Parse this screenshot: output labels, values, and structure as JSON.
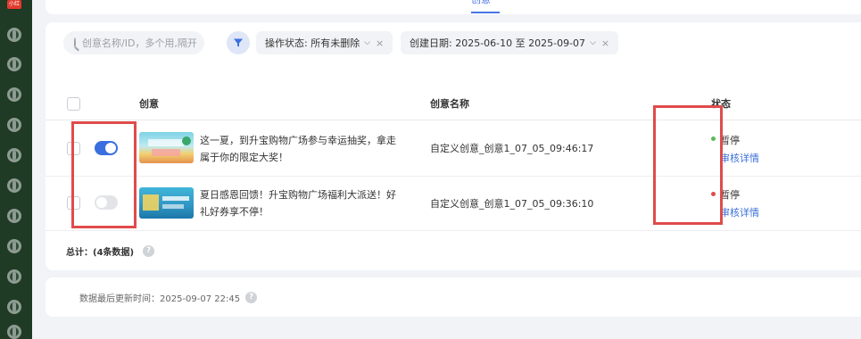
{
  "rail": {
    "logo_text": "小红书",
    "icons": [
      "globe-icon",
      "globe-icon",
      "globe-icon",
      "globe-icon",
      "globe-icon",
      "globe-icon",
      "globe-icon",
      "globe-icon",
      "globe-icon",
      "globe-icon",
      "globe-icon",
      "globe-icon",
      "globe-icon"
    ]
  },
  "top_tab": {
    "label": "创意"
  },
  "filters": {
    "search_placeholder": "创意名称/ID，多个用,隔开",
    "status_chip": "操作状态: 所有未删除",
    "date_chip": "创建日期: 2025-06-10 至 2025-09-07"
  },
  "table": {
    "columns": [
      "创意",
      "创意名称",
      "状态"
    ],
    "rows": [
      {
        "enabled": true,
        "desc": "这一夏，到升宝购物广场参与幸运抽奖，拿走属于你的限定大奖！",
        "name": "自定义创意_创意1_07_05_09:46:17",
        "status": "暂停",
        "status_color": "#5cb85c",
        "link": "审核详情"
      },
      {
        "enabled": false,
        "desc": "夏日感恩回馈！升宝购物广场福利大派送！好礼好券享不停！",
        "name": "自定义创意_创意1_07_05_09:36:10",
        "status": "暂停",
        "status_color": "#e04b4b",
        "link": "审核详情"
      }
    ]
  },
  "total": "总计：(4条数据)",
  "footer": {
    "update_text": "数据最后更新时间：2025-09-07 22:45"
  },
  "colors": {
    "accent": "#4a74e6",
    "highlight": "#e04b4b"
  }
}
